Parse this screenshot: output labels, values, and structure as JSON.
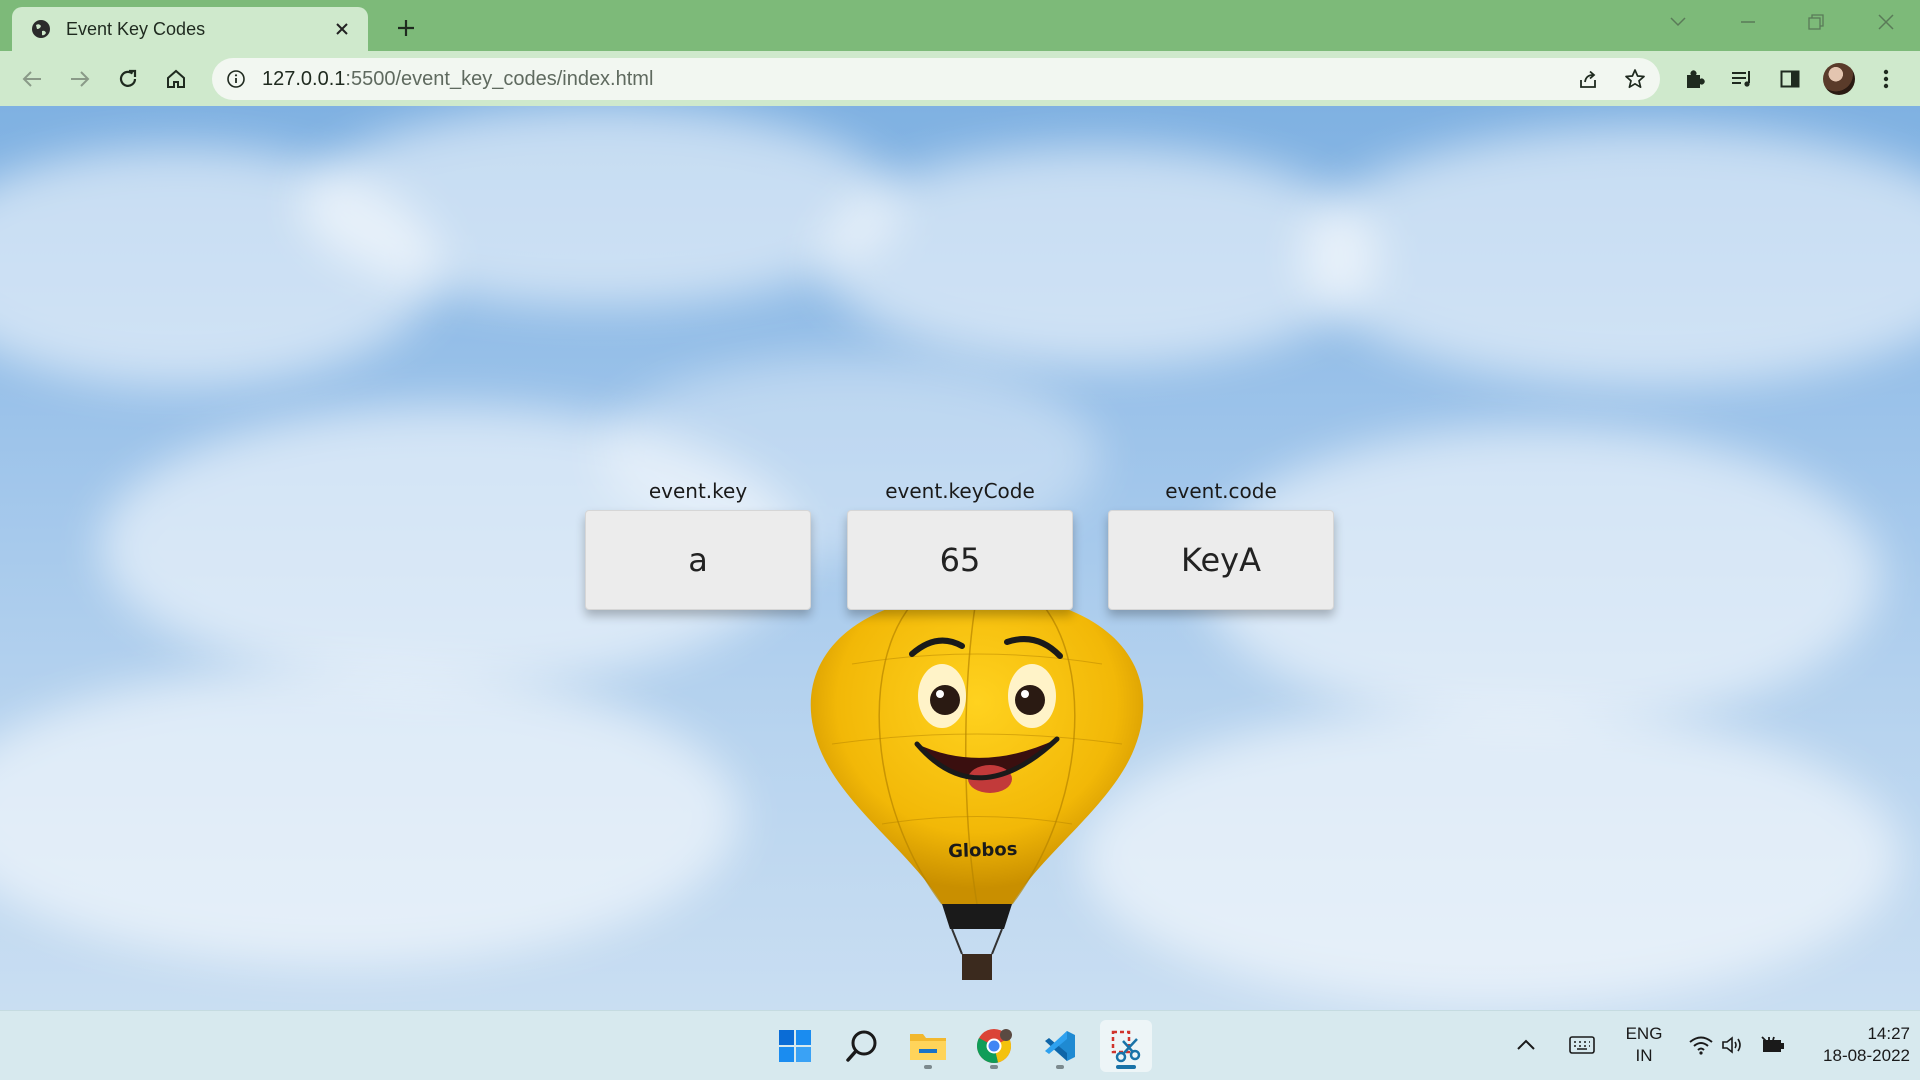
{
  "browser": {
    "tab_title": "Event Key Codes",
    "url_host": "127.0.0.1",
    "url_rest": ":5500/event_key_codes/index.html"
  },
  "page": {
    "keys": [
      {
        "label": "event.key",
        "value": "a"
      },
      {
        "label": "event.keyCode",
        "value": "65"
      },
      {
        "label": "event.code",
        "value": "KeyA"
      }
    ],
    "balloon_text": "Globos"
  },
  "taskbar": {
    "apps": [
      "windows-start",
      "search",
      "file-explorer",
      "chrome",
      "vscode",
      "snipping-tool"
    ],
    "language_line1": "ENG",
    "language_line2": "IN",
    "time": "14:27",
    "date": "18-08-2022"
  },
  "colors": {
    "tabbar": "#7dba79",
    "toolbar": "#cfe9cc",
    "balloon": "#f2b807",
    "taskbar": "#d7e9ee"
  }
}
